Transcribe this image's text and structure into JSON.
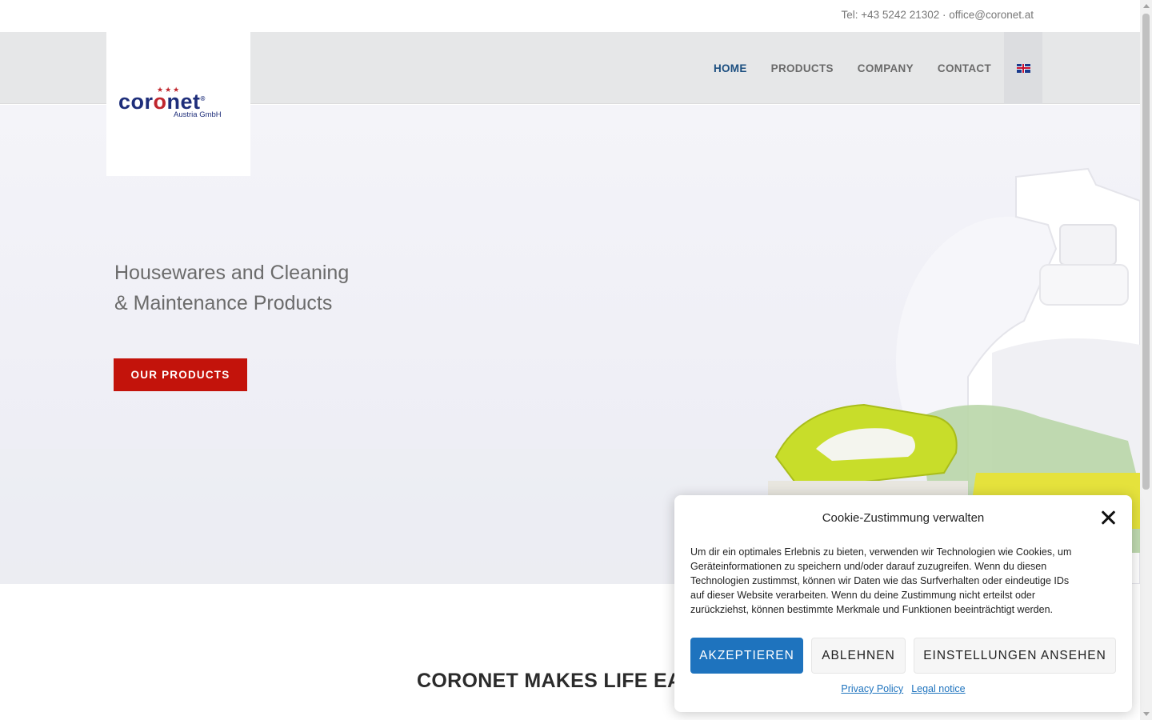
{
  "topbar": {
    "contact": "Tel: +43 5242 21302 · office@coronet.at"
  },
  "logo": {
    "word_start": "cor",
    "word_o": "o",
    "word_end": "net",
    "registered": "®",
    "subtitle": "Austria GmbH"
  },
  "nav": {
    "items": [
      {
        "label": "HOME",
        "active": true
      },
      {
        "label": "PRODUCTS",
        "active": false
      },
      {
        "label": "COMPANY",
        "active": false
      },
      {
        "label": "CONTACT",
        "active": false
      }
    ],
    "language_icon": "uk-flag-icon"
  },
  "hero": {
    "title_line1": "Housewares and Cleaning",
    "title_line2": "& Maintenance Products",
    "cta_label": "OUR PRODUCTS"
  },
  "section": {
    "title": "CORONET MAKES LIFE EA"
  },
  "cookie": {
    "title": "Cookie-Zustimmung verwalten",
    "body": "Um dir ein optimales Erlebnis zu bieten, verwenden wir Technologien wie Cookies, um Geräteinformationen zu speichern und/oder darauf zuzugreifen. Wenn du diesen Technologien zustimmst, können wir Daten wie das Surfverhalten oder eindeutige IDs auf dieser Website verarbeiten. Wenn du deine Zustimmung nicht erteilst oder zurückziehst, können bestimmte Merkmale und Funktionen beeinträchtigt werden.",
    "accept_label": "AKZEPTIEREN",
    "deny_label": "ABLEHNEN",
    "settings_label": "EINSTELLUNGEN ANSEHEN",
    "privacy_link": "Privacy Policy",
    "legal_link": "Legal notice"
  },
  "colors": {
    "accent_red": "#c3130b",
    "nav_active": "#1c4f80",
    "cookie_blue": "#1e73be",
    "logo_navy": "#1e2e7a"
  }
}
